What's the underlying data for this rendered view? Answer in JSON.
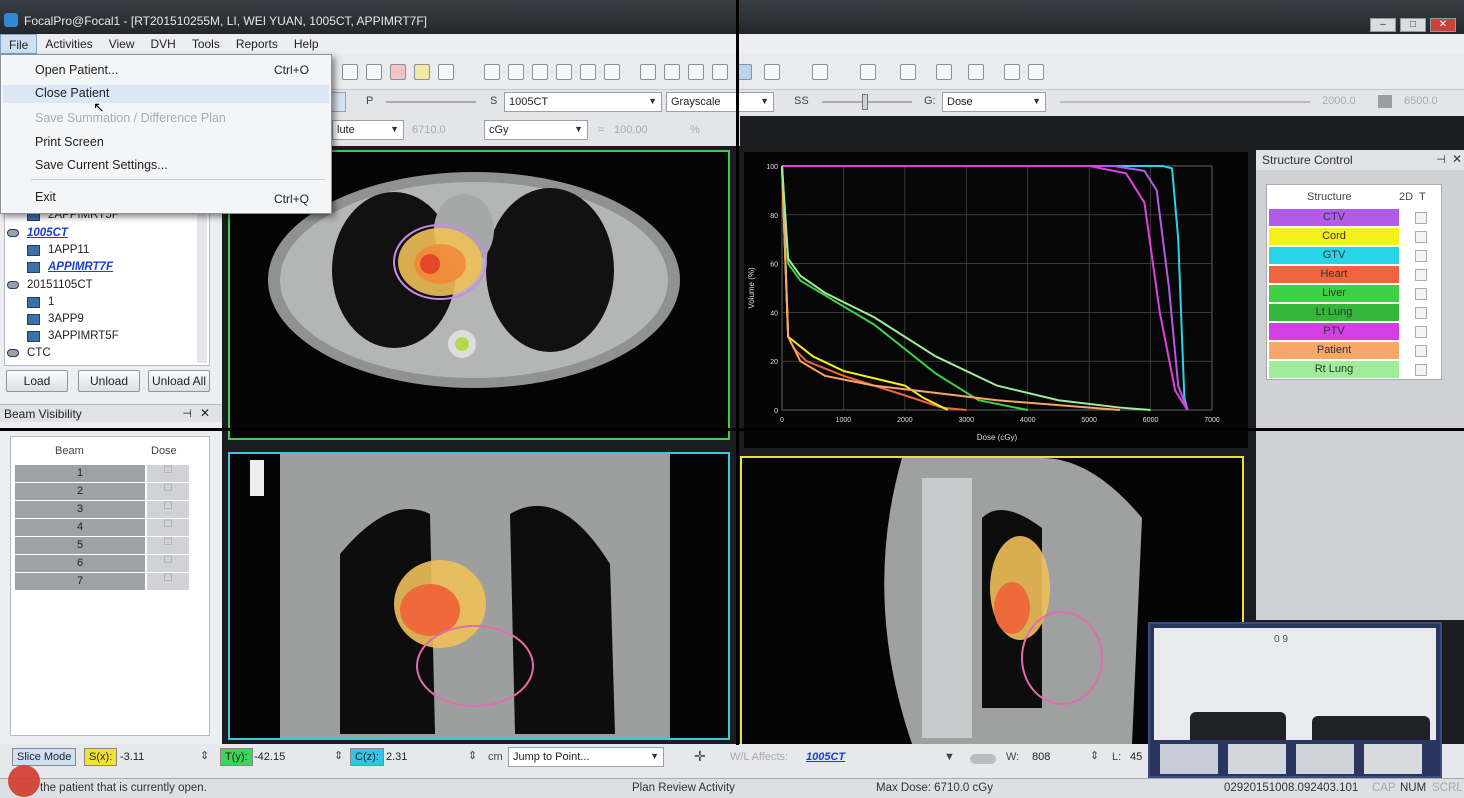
{
  "window": {
    "title": "FocalPro@Focal1 - [RT201510255M, LI, WEI YUAN, 1005CT, APPIMRT7F]",
    "controls": [
      "–",
      "□",
      "✕"
    ]
  },
  "menubar": [
    "File",
    "Activities",
    "View",
    "DVH",
    "Tools",
    "Reports",
    "Help"
  ],
  "file_menu": {
    "items": [
      {
        "label": "Open Patient...",
        "shortcut": "Ctrl+O",
        "enabled": true
      },
      {
        "label": "Close Patient",
        "shortcut": "",
        "enabled": true
      },
      {
        "label": "Save Summation / Difference Plan",
        "shortcut": "",
        "enabled": false
      },
      {
        "label": "Print Screen",
        "shortcut": "",
        "enabled": true
      },
      {
        "label": "Save Current Settings...",
        "shortcut": "",
        "enabled": true
      },
      {
        "label": "Exit",
        "shortcut": "Ctrl+Q",
        "enabled": true
      }
    ]
  },
  "options": {
    "p_label": "P",
    "s_label": "S",
    "s_value": "1005CT",
    "colormap": "Grayscale",
    "ss_label": "SS",
    "g_label": "G:",
    "g_value": "Dose",
    "range_min": "2000.0",
    "range_max": "6500.0",
    "dose_mode": "lute",
    "dose_ref": "6710.0",
    "dose_unit": "cGy",
    "percent_value": "100.00",
    "percent_sign": "%"
  },
  "tree": {
    "items": [
      {
        "label": "2APPIMRT5F",
        "kind": "plan",
        "link": false
      },
      {
        "label": "1005CT",
        "kind": "group",
        "link": true
      },
      {
        "label": "1APP11",
        "kind": "plan",
        "link": false
      },
      {
        "label": "APPIMRT7F",
        "kind": "plan",
        "link": true
      },
      {
        "label": "20151105CT",
        "kind": "group",
        "link": false
      },
      {
        "label": "1",
        "kind": "plan",
        "link": false
      },
      {
        "label": "3APP9",
        "kind": "plan",
        "link": false
      },
      {
        "label": "3APPIMRT5F",
        "kind": "plan",
        "link": false
      },
      {
        "label": "CTC",
        "kind": "group",
        "link": false
      }
    ]
  },
  "tree_buttons": [
    "Load",
    "Unload",
    "Unload All"
  ],
  "beam_visibility": {
    "title": "Beam Visibility",
    "columns": [
      "Beam",
      "Dose"
    ],
    "beams": [
      "1",
      "2",
      "3",
      "4",
      "5",
      "6",
      "7"
    ]
  },
  "structure_control": {
    "title": "Structure Control",
    "columns": [
      "Structure",
      "2D",
      "T"
    ],
    "structures": [
      {
        "name": "CTV",
        "color": "#b35be8"
      },
      {
        "name": "Cord",
        "color": "#f4f11a"
      },
      {
        "name": "GTV",
        "color": "#27d6e6"
      },
      {
        "name": "Heart",
        "color": "#f0653e"
      },
      {
        "name": "Liver",
        "color": "#3fd043"
      },
      {
        "name": "Lt Lung",
        "color": "#35b53a"
      },
      {
        "name": "PTV",
        "color": "#d23fe4"
      },
      {
        "name": "Patient",
        "color": "#f7a768"
      },
      {
        "name": "Rt Lung",
        "color": "#9fec9a"
      }
    ]
  },
  "chart_data": {
    "type": "line",
    "title": "",
    "xlabel": "Dose (cGy)",
    "ylabel": "Volume (%)",
    "xlim": [
      0,
      7000
    ],
    "ylim": [
      0,
      100
    ],
    "xticks": [
      0,
      1000,
      2000,
      3000,
      4000,
      5000,
      6000,
      7000
    ],
    "yticks": [
      0,
      20,
      40,
      60,
      80,
      100
    ],
    "grid": true,
    "series": [
      {
        "color": "#27d6e6",
        "x": [
          0,
          5000,
          6200,
          6350,
          6450,
          6550,
          6600
        ],
        "y": [
          100,
          100,
          100,
          99,
          70,
          5,
          0
        ]
      },
      {
        "color": "#b35be8",
        "x": [
          0,
          5400,
          5900,
          6100,
          6300,
          6450,
          6600
        ],
        "y": [
          100,
          100,
          98,
          90,
          50,
          10,
          0
        ]
      },
      {
        "color": "#e33fe0",
        "x": [
          0,
          5000,
          5600,
          5900,
          6150,
          6400,
          6600
        ],
        "y": [
          100,
          100,
          97,
          85,
          40,
          8,
          0
        ]
      },
      {
        "color": "#f0653e",
        "x": [
          0,
          100,
          200,
          400,
          1000,
          2000,
          2600,
          3000
        ],
        "y": [
          100,
          30,
          25,
          20,
          14,
          6,
          1,
          0
        ]
      },
      {
        "color": "#f4f11a",
        "x": [
          0,
          100,
          250,
          500,
          1000,
          2000,
          2300,
          2700
        ],
        "y": [
          100,
          30,
          27,
          22,
          16,
          10,
          5,
          0
        ]
      },
      {
        "color": "#3fd043",
        "x": [
          0,
          100,
          300,
          700,
          1500,
          2500,
          3200,
          4000
        ],
        "y": [
          100,
          60,
          53,
          47,
          35,
          15,
          4,
          0
        ]
      },
      {
        "color": "#f7a768",
        "x": [
          0,
          100,
          300,
          700,
          1500,
          2500,
          3500,
          4500,
          5500
        ],
        "y": [
          100,
          30,
          20,
          14,
          10,
          7,
          4,
          2,
          0
        ]
      },
      {
        "color": "#9fec9a",
        "x": [
          0,
          100,
          300,
          700,
          1500,
          2500,
          3500,
          4500,
          5500,
          6000
        ],
        "y": [
          100,
          62,
          55,
          48,
          38,
          22,
          10,
          4,
          1,
          0
        ]
      }
    ]
  },
  "bottom": {
    "slice_mode": "Slice Mode",
    "s_label": "S(x):",
    "s_value": "-3.11",
    "t_label": "T(y):",
    "t_value": "-42.15",
    "c_label": "C(z):",
    "c_value": "2.31",
    "unit": "cm",
    "jump": "Jump to Point...",
    "wl_affects_label": "W/L Affects:",
    "wl_affects_value": "1005CT",
    "w_label": "W:",
    "w_value": "808",
    "l_label": "L:",
    "l_value": "45"
  },
  "status": {
    "left": "the patient that is currently open.",
    "center": "Plan Review Activity",
    "maxdose": "Max Dose: 6710.0 cGy",
    "right": "02920151008.092403.101",
    "caps": "CAP",
    "num": "NUM",
    "scrl": "SCRL"
  },
  "video_call": {
    "indicator": "0 9"
  }
}
